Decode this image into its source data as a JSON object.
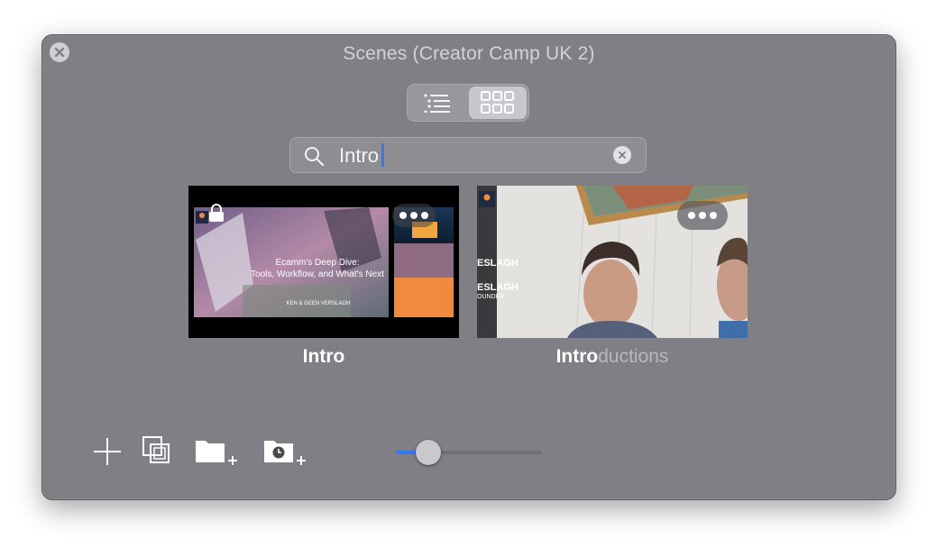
{
  "window": {
    "title": "Scenes (Creator Camp UK 2)"
  },
  "search": {
    "value": "Intro"
  },
  "scenes": [
    {
      "label_match": "Intro",
      "label_rest": "",
      "selected": true,
      "thumb_title_line1": "Ecamm's Deep Dive:",
      "thumb_title_line2": "Tools, Workflow, and What's Next",
      "thumb_names": "KEN & GEEN VERSLAGH"
    },
    {
      "label_match": "Intro",
      "label_rest": "ductions",
      "selected": false,
      "thumb_name1": "ESLAGH",
      "thumb_name2": "ESLAGH",
      "thumb_role": "OUNDER"
    }
  ],
  "zoom_slider": {
    "value_fraction": 0.22
  },
  "colors": {
    "panel_bg": "#807f85",
    "accent": "#3478f6",
    "matched_text": "#ffffff",
    "unmatched_text": "#b9b8bd"
  },
  "icons": {
    "close": "close-icon",
    "list_view": "list-view-icon",
    "grid_view": "grid-view-icon",
    "search": "search-icon",
    "clear": "clear-icon",
    "add_scene": "plus-icon",
    "duplicate": "duplicate-icon",
    "new_folder": "new-folder-icon",
    "scheduled_folder": "scheduled-folder-icon",
    "lock": "lock-icon",
    "more": "ellipsis-icon"
  }
}
